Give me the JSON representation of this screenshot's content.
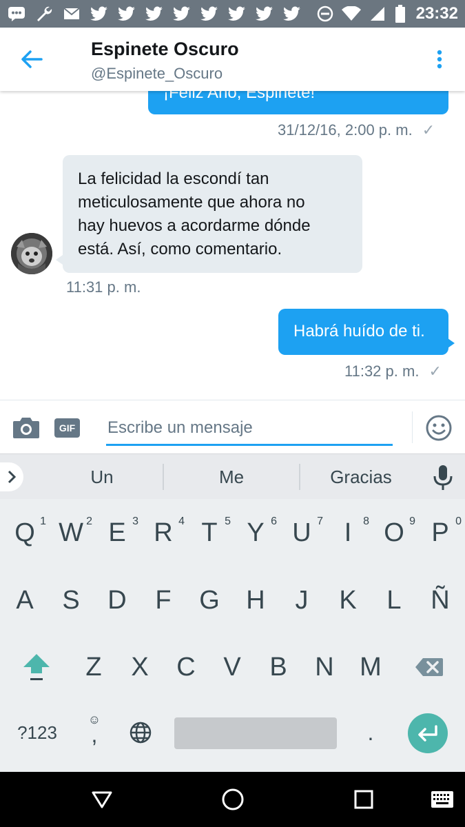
{
  "status_bar": {
    "time": "23:32",
    "icons": [
      "messages-icon",
      "wrench-icon",
      "mail-icon",
      "twitter-icon",
      "twitter-icon",
      "twitter-icon",
      "twitter-icon",
      "twitter-icon",
      "twitter-icon",
      "twitter-icon",
      "twitter-icon",
      "do-not-disturb-icon",
      "wifi-icon",
      "signal-icon",
      "battery-icon"
    ]
  },
  "header": {
    "name": "Espinete Oscuro",
    "handle": "@Espinete_Oscuro",
    "back_icon": "back-arrow-icon",
    "more_icon": "more-vertical-icon"
  },
  "conversation": {
    "messages": [
      {
        "direction": "outgoing",
        "text": "¡Feliz Año, Espinete!",
        "time": "31/12/16, 2:00 p. m.",
        "status": "✓"
      },
      {
        "direction": "incoming",
        "lines": [
          "La felicidad la escondí tan",
          "meticulosamente que ahora no",
          "hay huevos a acordarme dónde",
          "está. Así, como comentario."
        ],
        "time": "11:31 p. m."
      },
      {
        "direction": "outgoing",
        "text": "Habrá huído de ti.",
        "time": "11:32 p. m.",
        "status": "✓"
      }
    ]
  },
  "compose": {
    "placeholder": "Escribe un mensaje",
    "gif_label": "GIF",
    "camera_icon": "camera-icon",
    "emoji_icon": "emoji-icon"
  },
  "keyboard": {
    "suggestions": [
      "Un",
      "Me",
      "Gracias"
    ],
    "row1": [
      {
        "label": "Q",
        "hint": "1"
      },
      {
        "label": "W",
        "hint": "2"
      },
      {
        "label": "E",
        "hint": "3"
      },
      {
        "label": "R",
        "hint": "4"
      },
      {
        "label": "T",
        "hint": "5"
      },
      {
        "label": "Y",
        "hint": "6"
      },
      {
        "label": "U",
        "hint": "7"
      },
      {
        "label": "I",
        "hint": "8"
      },
      {
        "label": "O",
        "hint": "9"
      },
      {
        "label": "P",
        "hint": "0"
      }
    ],
    "row2": [
      "A",
      "S",
      "D",
      "F",
      "G",
      "H",
      "J",
      "K",
      "L",
      "Ñ"
    ],
    "row3": [
      "Z",
      "X",
      "C",
      "V",
      "B",
      "N",
      "M"
    ],
    "symbols_label": "?123",
    "comma_label": ",",
    "period_label": ".",
    "accent_color": "#4db6ac"
  },
  "colors": {
    "brand_blue": "#1da1f2",
    "incoming_bubble": "#e6ecf0",
    "status_bar": "#6b7680"
  }
}
